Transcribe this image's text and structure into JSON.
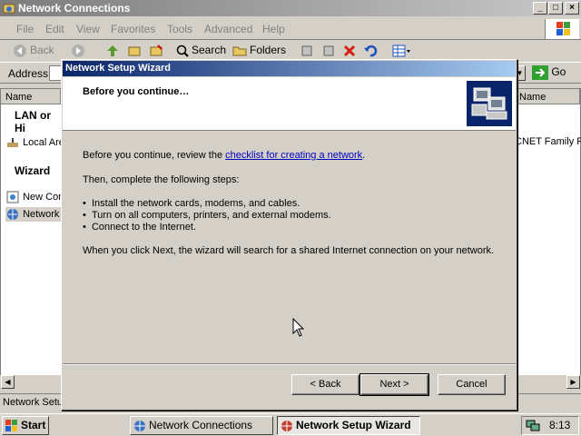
{
  "explorer": {
    "title": "Network Connections",
    "menu": [
      "File",
      "Edit",
      "View",
      "Favorites",
      "Tools",
      "Advanced",
      "Help"
    ],
    "toolbar": {
      "back": "Back",
      "search": "Search",
      "folders": "Folders"
    },
    "address_label": "Address",
    "go_label": "Go",
    "left_pane": {
      "column_header": "Name",
      "group1": "LAN or Hi",
      "item1": "Local Are",
      "group2": "Wizard",
      "item2": "New Con",
      "item3": "Network"
    },
    "right_pane": {
      "column_header": "Name",
      "item1": "CNET Family PC"
    },
    "status": "Network Setu"
  },
  "wizard": {
    "title": "Network Setup Wizard",
    "heading": "Before you continue…",
    "intro_prefix": "Before you continue, review the ",
    "intro_link": "checklist for creating a network",
    "intro_suffix": ".",
    "steps_intro": "Then, complete the following steps:",
    "steps": [
      "Install the network cards, modems, and cables.",
      "Turn on all computers, printers, and external modems.",
      "Connect to the Internet."
    ],
    "note": "When you click Next, the wizard will search for a shared Internet connection on your network.",
    "back_label": "< Back",
    "next_label": "Next >",
    "cancel_label": "Cancel"
  },
  "taskbar": {
    "start": "Start",
    "tasks": [
      "Network Connections",
      "Network Setup Wizard"
    ],
    "clock": "8:13"
  }
}
